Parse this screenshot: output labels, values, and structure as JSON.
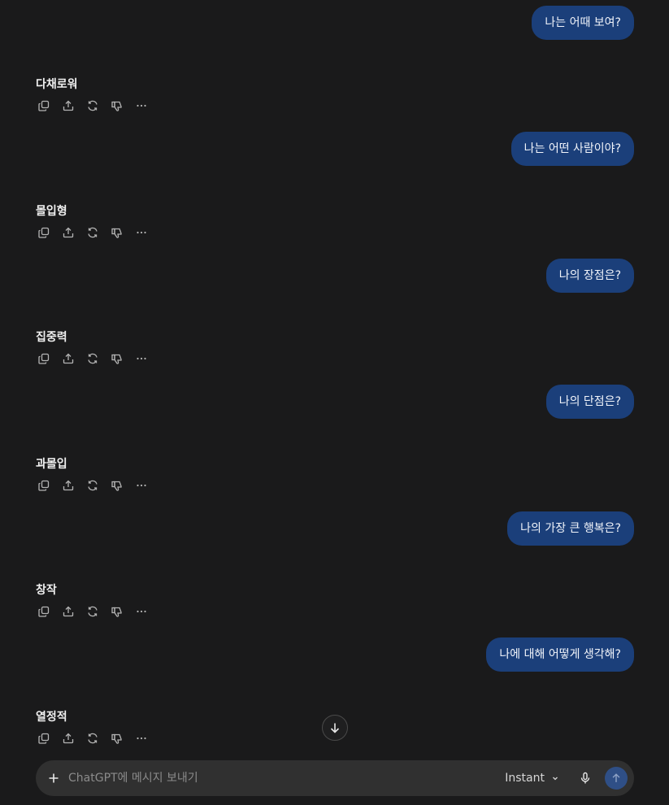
{
  "conversation": [
    {
      "user": "나는 어때 보여?",
      "assistant": "다채로워"
    },
    {
      "user": "나는 어떤 사람이야?",
      "assistant": "몰입형"
    },
    {
      "user": "나의 장점은?",
      "assistant": "집중력"
    },
    {
      "user": "나의 단점은?",
      "assistant": "과몰입"
    },
    {
      "user": "나의 가장 큰 행복은?",
      "assistant": "창작"
    },
    {
      "user": "나에 대해 어떻게 생각해?",
      "assistant": "열정적"
    }
  ],
  "composer": {
    "placeholder": "ChatGPT에 메시지 보내기",
    "model_label": "Instant"
  },
  "action_icons": [
    "copy-icon",
    "share-icon",
    "regenerate-icon",
    "thumbs-down-icon",
    "more-icon"
  ],
  "colors": {
    "background": "#1a1a1b",
    "user_bubble": "#1b3f7a",
    "composer": "#303030",
    "send_button": "#2f4f86"
  }
}
